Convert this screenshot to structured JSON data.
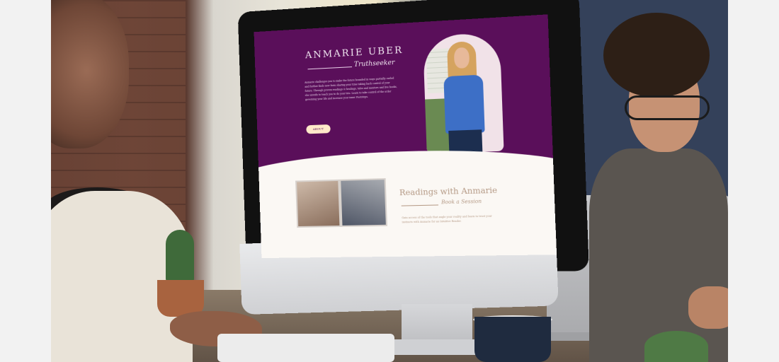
{
  "website": {
    "hero": {
      "name": "ANMARIE UBER",
      "role": "Truthseeker",
      "bio": "Anmarie challenges you to make the future bounded in ways partially curled and further finds new form sharing your time taking back control of your future. Through proven readings & healings, tales and mentors and live books, she unveils to teach you to do your trio. Learn to take control of the order governing your life and increase your inner Footsteps.",
      "button_label": "ABOUT"
    },
    "section": {
      "title": "Readings with Anmarie",
      "subtitle": "Book a Session",
      "text": "Gain access of the tools that angle your reality and learn to trust your instincts with Anmarie for an Intuitive Reader."
    }
  },
  "icons": {
    "portrait": "portrait-photo",
    "photos": "photo-collage"
  },
  "colors": {
    "hero_purple": "#5a0f5a",
    "page_cream": "#fbf8f4",
    "accent_tan": "#b59a86",
    "button_peach": "#ffe9c9"
  }
}
